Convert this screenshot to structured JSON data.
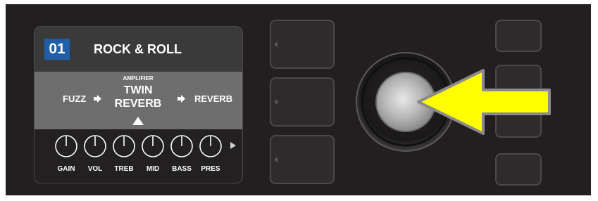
{
  "preset": {
    "number": "01",
    "name": "ROCK & ROLL"
  },
  "chain": {
    "left": "FUZZ",
    "amp_label": "AMPLIFIER",
    "amp_name_line1": "TWIN",
    "amp_name_line2": "REVERB",
    "right": "REVERB"
  },
  "knobs": [
    {
      "label": "GAIN"
    },
    {
      "label": "VOL"
    },
    {
      "label": "TREB"
    },
    {
      "label": "MID"
    },
    {
      "label": "BASS"
    },
    {
      "label": "PRES"
    }
  ],
  "colors": {
    "highlight": "#1f5ea8",
    "arrow_fill": "#ffff00",
    "arrow_stroke": "#8a8a8a"
  }
}
